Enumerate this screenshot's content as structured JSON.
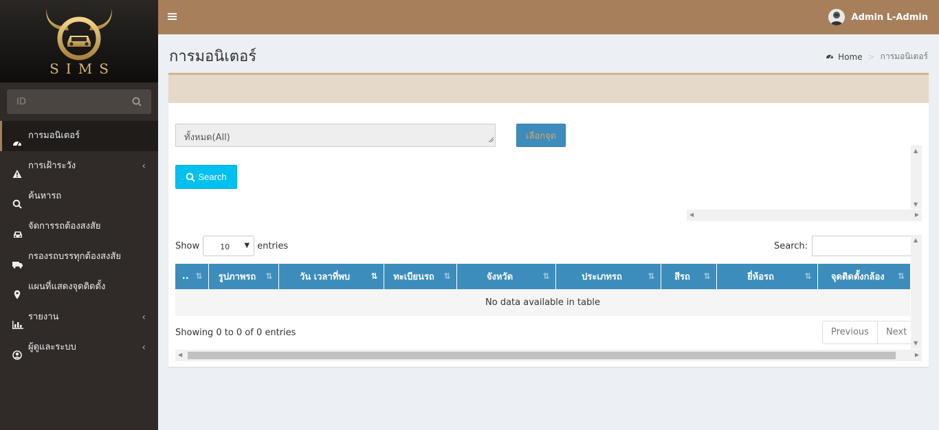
{
  "brand": {
    "logo_text": "SIMS",
    "accent": "#a87f5b",
    "gold": "#d9b66b"
  },
  "sidebar": {
    "search_placeholder": "ID",
    "items": [
      {
        "label": "การมอนิเตอร์",
        "icon": "dashboard-icon",
        "active": true,
        "has_children": false
      },
      {
        "label": "การเฝ้าระวัง",
        "icon": "warning-icon",
        "active": false,
        "has_children": true
      },
      {
        "label": "ค้นหารถ",
        "icon": "search-icon",
        "active": false,
        "has_children": false
      },
      {
        "label": "จัดการรถต้องสงสัย",
        "icon": "car-icon",
        "active": false,
        "has_children": false
      },
      {
        "label": "กรองรถบรรทุกต้องสงสัย",
        "icon": "truck-icon",
        "active": false,
        "has_children": false
      },
      {
        "label": "แผนที่แสดงจุดติดตั้ง",
        "icon": "map-marker-icon",
        "active": false,
        "has_children": false
      },
      {
        "label": "รายงาน",
        "icon": "bar-chart-icon",
        "active": false,
        "has_children": true
      },
      {
        "label": "ผู้ดูและระบบ",
        "icon": "user-circle-icon",
        "active": false,
        "has_children": true
      }
    ]
  },
  "header": {
    "user_name": "Admin L-Admin"
  },
  "page": {
    "title": "การมอนิเตอร์"
  },
  "breadcrumb": {
    "home": "Home",
    "current": "การมอนิเตอร์"
  },
  "filters": {
    "point_value": "ทั้งหมด(All)",
    "pick_button": "เลือกจุด",
    "search_button": "Search"
  },
  "datatable": {
    "show_label": "Show",
    "entries_label": "entries",
    "page_size": "10",
    "search_label": "Search:",
    "columns": [
      "..",
      "รูปภาพรถ",
      "วัน เวลาที่พบ",
      "ทะเบียนรถ",
      "จังหวัด",
      "ประเภทรถ",
      "สีรถ",
      "ยี่ห้อรถ",
      "จุดติดตั้งกล้อง"
    ],
    "empty_message": "No data available in table",
    "info": "Showing 0 to 0 of 0 entries",
    "prev": "Previous",
    "next": "Next"
  },
  "colors": {
    "table_header": "#3c8dbc",
    "search_button": "#00c0ef",
    "box_header": "#e5d9c9",
    "sidebar_bg": "#302b28"
  }
}
